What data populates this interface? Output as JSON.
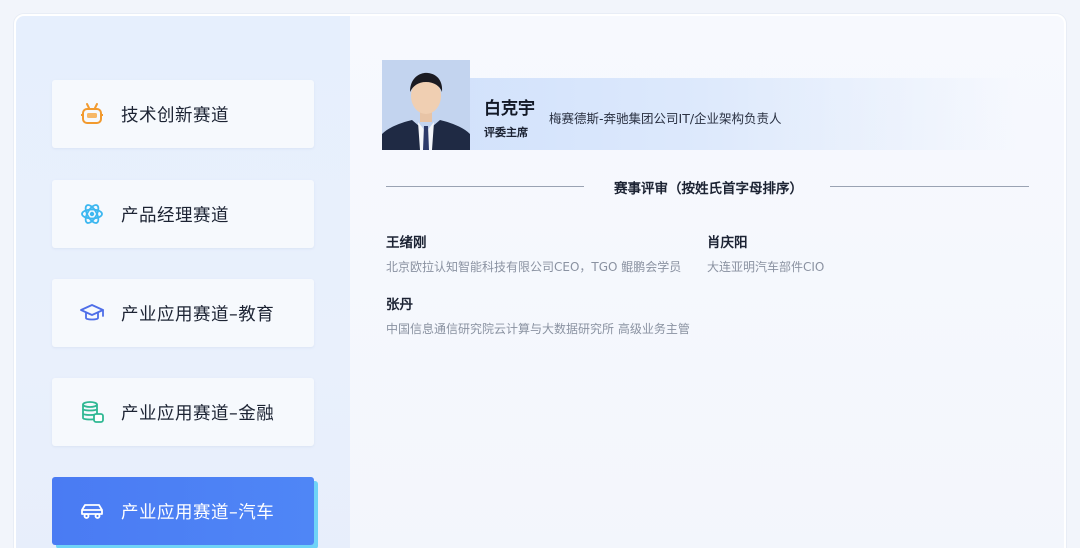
{
  "nav": {
    "items": [
      {
        "label": "技术创新赛道",
        "icon": "robot-icon",
        "active": false
      },
      {
        "label": "产品经理赛道",
        "icon": "atom-icon",
        "active": false
      },
      {
        "label": "产业应用赛道–教育",
        "icon": "graduation-cap-icon",
        "active": false
      },
      {
        "label": "产业应用赛道–金融",
        "icon": "coins-icon",
        "active": false
      },
      {
        "label": "产业应用赛道–汽车",
        "icon": "car-icon",
        "active": true
      }
    ]
  },
  "chief": {
    "name": "白克宇",
    "role": "评委主席",
    "title": "梅赛德斯-奔驰集团公司IT/企业架构负责人"
  },
  "section_title": "赛事评审（按姓氏首字母排序）",
  "judges": [
    {
      "name": "王绪刚",
      "org": "北京欧拉认知智能科技有限公司CEO，TGO 鲲鹏会学员"
    },
    {
      "name": "肖庆阳",
      "org": "大连亚明汽车部件CIO"
    },
    {
      "name": "张丹",
      "org": "中国信息通信研究院云计算与大数据研究所 高级业务主管"
    }
  ],
  "colors": {
    "accent": "#4a7bf3",
    "accent_shadow": "#6fd3f7",
    "robot_icon": "#f29a2e",
    "atom_icon": "#3cb7f0",
    "cap_icon": "#4e6ee8",
    "coins_icon": "#2fb893",
    "car_icon": "#ffffff"
  }
}
